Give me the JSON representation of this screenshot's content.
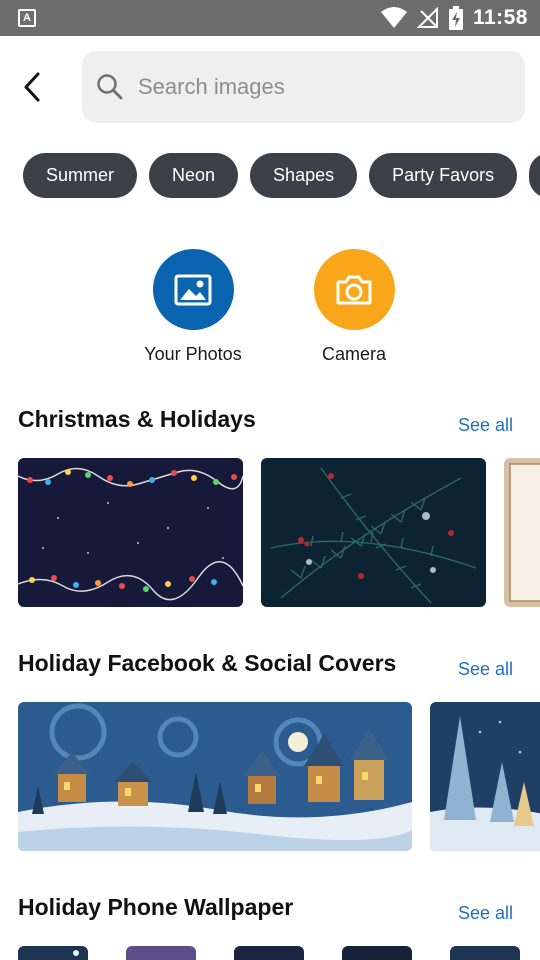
{
  "status_bar": {
    "time": "11:58",
    "app_badge": "A"
  },
  "search": {
    "placeholder": "Search images",
    "value": ""
  },
  "chips": [
    "Summer",
    "Neon",
    "Shapes",
    "Party Favors"
  ],
  "sources": [
    {
      "label": "Your Photos",
      "icon": "image-icon",
      "color": "#0a64b0"
    },
    {
      "label": "Camera",
      "icon": "camera-icon",
      "color": "#f9a61a"
    }
  ],
  "sections": [
    {
      "title": "Christmas & Holidays",
      "see_all": "See all"
    },
    {
      "title": "Holiday Facebook & Social Covers",
      "see_all": "See all"
    },
    {
      "title": "Holiday Phone Wallpaper",
      "see_all": "See all"
    }
  ],
  "colors": {
    "accent_link": "#1f6fc1",
    "chip_bg": "#3c4048",
    "status_bar": "#6d6d6d"
  }
}
